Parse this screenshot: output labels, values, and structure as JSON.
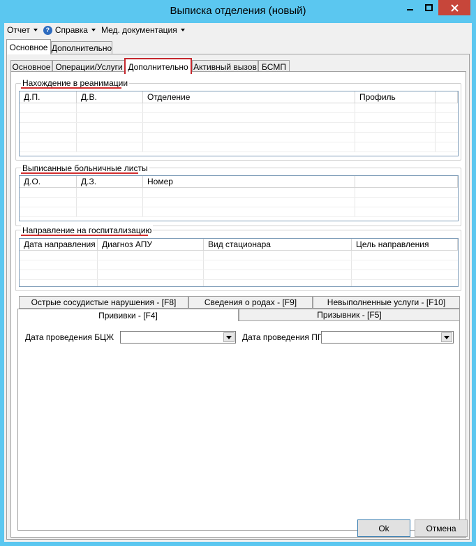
{
  "window": {
    "title": "Выписка отделения (новый)"
  },
  "menu": {
    "report": "Отчет",
    "help": "Справка",
    "med_docs": "Мед. документация"
  },
  "outer_tabs": {
    "main": "Основное",
    "additional": "Дополнительно"
  },
  "inner_tabs": {
    "main": "Основное",
    "operations": "Операции/Услуги",
    "additional": "Дополнительно",
    "active_call": "Активный вызов",
    "bsmp": "БСМП"
  },
  "reanimation": {
    "title": "Нахождение в реанимации",
    "columns": [
      "Д.П.",
      "Д.В.",
      "Отделение",
      "Профиль"
    ]
  },
  "sick_leaves": {
    "title": "Выписанные больничные листы",
    "columns": [
      "Д.О.",
      "Д.З.",
      "Номер"
    ]
  },
  "hospitalization": {
    "title": "Направление на госпитализацию",
    "columns": [
      "Дата направления",
      "Диагноз АПУ",
      "Вид стационара",
      "Цель направления"
    ]
  },
  "bottom_tabs": {
    "vascular": "Острые сосудистые нарушения - [F8]",
    "births": "Сведения о родах - [F9]",
    "unfulfilled": "Невыполненные услуги - [F10]",
    "vaccinations": "Прививки - [F4]",
    "conscript": "Призывник - [F5]"
  },
  "vaccinations": {
    "bcg_label": "Дата проведения БЦЖ",
    "pg_label": "Дата проведения ПГ",
    "bcg_value": "",
    "pg_value": ""
  },
  "buttons": {
    "ok": "Ok",
    "cancel": "Отмена"
  },
  "colors": {
    "titlebar": "#5bc7f0",
    "close": "#c7463a",
    "highlight": "#c4282e",
    "underline": "#d22d2d"
  }
}
